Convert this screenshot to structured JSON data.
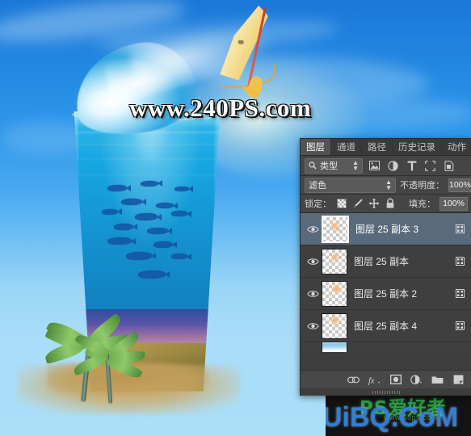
{
  "artwork": {
    "watermark_top": "www.240PS.com",
    "description_icons": {
      "sail": "windsurf-sail",
      "wave": "ocean-wave",
      "glass": "drinking-glass",
      "fish": "fish-school",
      "palm": "palm-tree",
      "sand": "beach-sand"
    }
  },
  "bottom_watermark": {
    "site": "UiBQ.CoM",
    "cn_logo": "PS爱好者",
    "cn_sub": "www.68ps.com"
  },
  "panel": {
    "tabs": [
      {
        "label": "图层",
        "active": true
      },
      {
        "label": "通道",
        "active": false
      },
      {
        "label": "路径",
        "active": false
      },
      {
        "label": "历史记录",
        "active": false
      },
      {
        "label": "动作",
        "active": false
      }
    ],
    "filter": {
      "kind_label": "类型",
      "search_icon": "search-icon",
      "icons": [
        "pixel-layer-icon",
        "adjustment-layer-icon",
        "type-layer-icon",
        "shape-layer-icon",
        "smart-object-icon"
      ]
    },
    "blend": {
      "mode": "滤色",
      "opacity_label": "不透明度：",
      "opacity_value": "100%"
    },
    "lock": {
      "label": "锁定：",
      "icons": [
        "lock-transparent-pixels-icon",
        "lock-image-pixels-icon",
        "lock-position-icon",
        "lock-all-icon"
      ],
      "fill_label": "填充：",
      "fill_value": "100%"
    },
    "layers": [
      {
        "name": "图层 25 副本 3",
        "selected": true,
        "visible": true,
        "thumb": "transparent"
      },
      {
        "name": "图层 25 副本",
        "selected": false,
        "visible": true,
        "thumb": "transparent"
      },
      {
        "name": "图层 25 副本 2",
        "selected": false,
        "visible": true,
        "thumb": "transparent"
      },
      {
        "name": "图层 25 副本 4",
        "selected": false,
        "visible": true,
        "thumb": "transparent"
      },
      {
        "name": "",
        "selected": false,
        "visible": true,
        "thumb": "sea"
      }
    ],
    "bottom_buttons": [
      "link-layers-icon",
      "layer-style-fx-icon",
      "add-layer-mask-icon",
      "new-adjustment-layer-icon",
      "new-group-icon",
      "new-layer-icon"
    ]
  },
  "colors": {
    "panel_bg": "#3d3d3d",
    "panel_row_bg": "#3f3f3f",
    "selected_row": "#5a6a7d",
    "accent_text": "#eaeaea",
    "sky_top": "#1a78d8",
    "sky_bottom": "#aadff8",
    "watermark_blue": "#2f7fd8",
    "logo_green": "#2f9b4a"
  }
}
